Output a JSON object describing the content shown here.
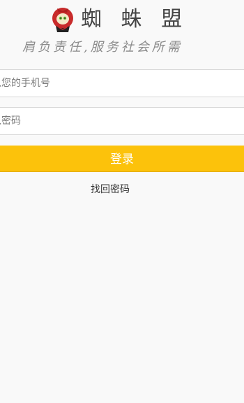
{
  "header": {
    "title": "蜘 蛛 盟",
    "slogan": "肩负责任,服务社会所需",
    "logo_icon": "spider-mascot-logo"
  },
  "login_form": {
    "phone_placeholder": "入您的手机号",
    "password_placeholder": "入密码",
    "login_label": "登录",
    "forgot_label": "找回密码"
  },
  "colors": {
    "accent": "#fcc20b",
    "background": "#f9f9f9"
  }
}
